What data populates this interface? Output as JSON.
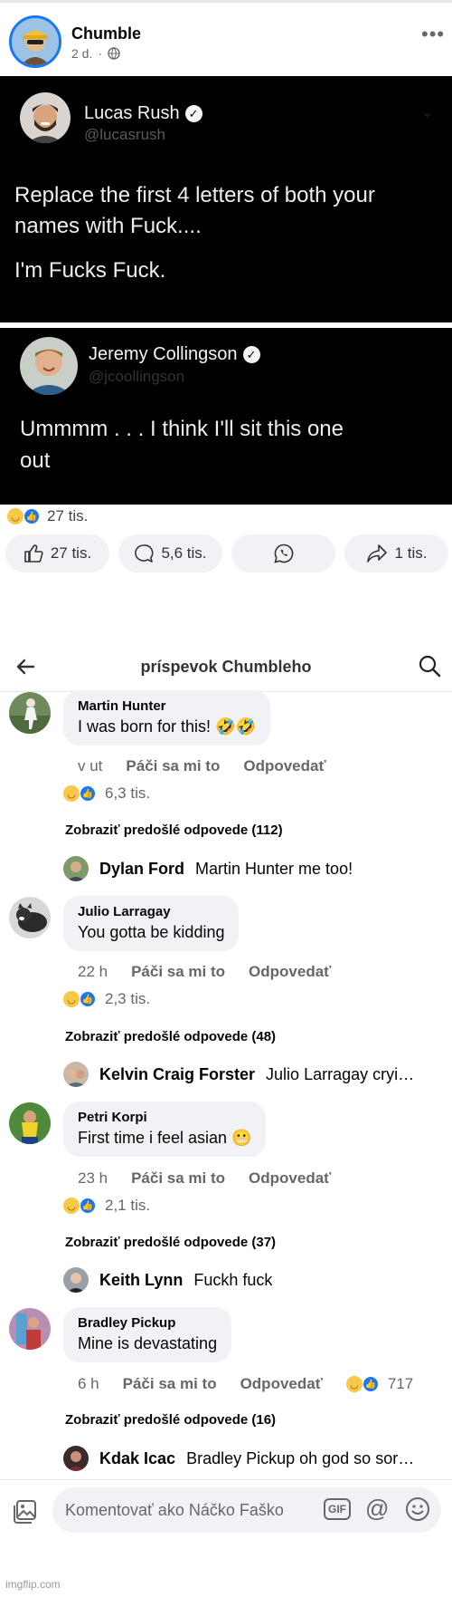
{
  "post": {
    "author": "Chumble",
    "time": "2 d.",
    "dot": "·",
    "tweets": [
      {
        "name": "Lucas Rush",
        "handle": "@lucasrush",
        "lines": [
          "Replace the first 4 letters of both your",
          "names with Fuck....",
          "I'm Fucks Fuck."
        ]
      },
      {
        "name": "Jeremy Collingson",
        "handle": "@jcoollingson",
        "lines": [
          "Ummmm . . . I think I'll sit this one",
          "out"
        ]
      }
    ],
    "reactions_count": "27 tis.",
    "actions": {
      "like": "27 tis.",
      "comment": "5,6 tis.",
      "share": "1 tis."
    }
  },
  "comments_page": {
    "title": "príspevok Chumbleho",
    "like_label": "Páči sa mi to",
    "reply_label": "Odpovedať",
    "comments": [
      {
        "name": "Martin Hunter",
        "text": "I was born for this! 🤣🤣",
        "time": "v ut",
        "reactions": "6,3 tis.",
        "prev_replies": "Zobraziť predošlé odpovede (112)",
        "reply": {
          "name": "Dylan Ford",
          "text": "Martin Hunter me too!"
        }
      },
      {
        "name": "Julio Larragay",
        "text": "You gotta be kidding",
        "time": "22 h",
        "reactions": "2,3 tis.",
        "prev_replies": "Zobraziť predošlé odpovede (48)",
        "reply": {
          "name": "Kelvin Craig Forster",
          "text": "Julio Larragay cryi…"
        }
      },
      {
        "name": "Petri Korpi",
        "text": "First time i feel asian 😬",
        "time": "23 h",
        "reactions": "2,1 tis.",
        "prev_replies": "Zobraziť predošlé odpovede (37)",
        "reply": {
          "name": "Keith Lynn",
          "text": "Fuckh fuck"
        }
      },
      {
        "name": "Bradley Pickup",
        "text": "Mine is devastating",
        "time": "6 h",
        "reactions": "717",
        "prev_replies": "Zobraziť predošlé odpovede (16)",
        "reply": {
          "name": "Kdak Icac",
          "text": "Bradley Pickup oh god so sor…"
        }
      }
    ]
  },
  "composer": {
    "placeholder": "Komentovať ako Náčko Faško",
    "gif": "GIF",
    "at": "@"
  },
  "watermark": "imgflip.com",
  "colors": {
    "accent": "#1877f2",
    "tweet_bg": "#000000",
    "bubble_bg": "#f0f2f5",
    "muted_text": "#65676b"
  }
}
